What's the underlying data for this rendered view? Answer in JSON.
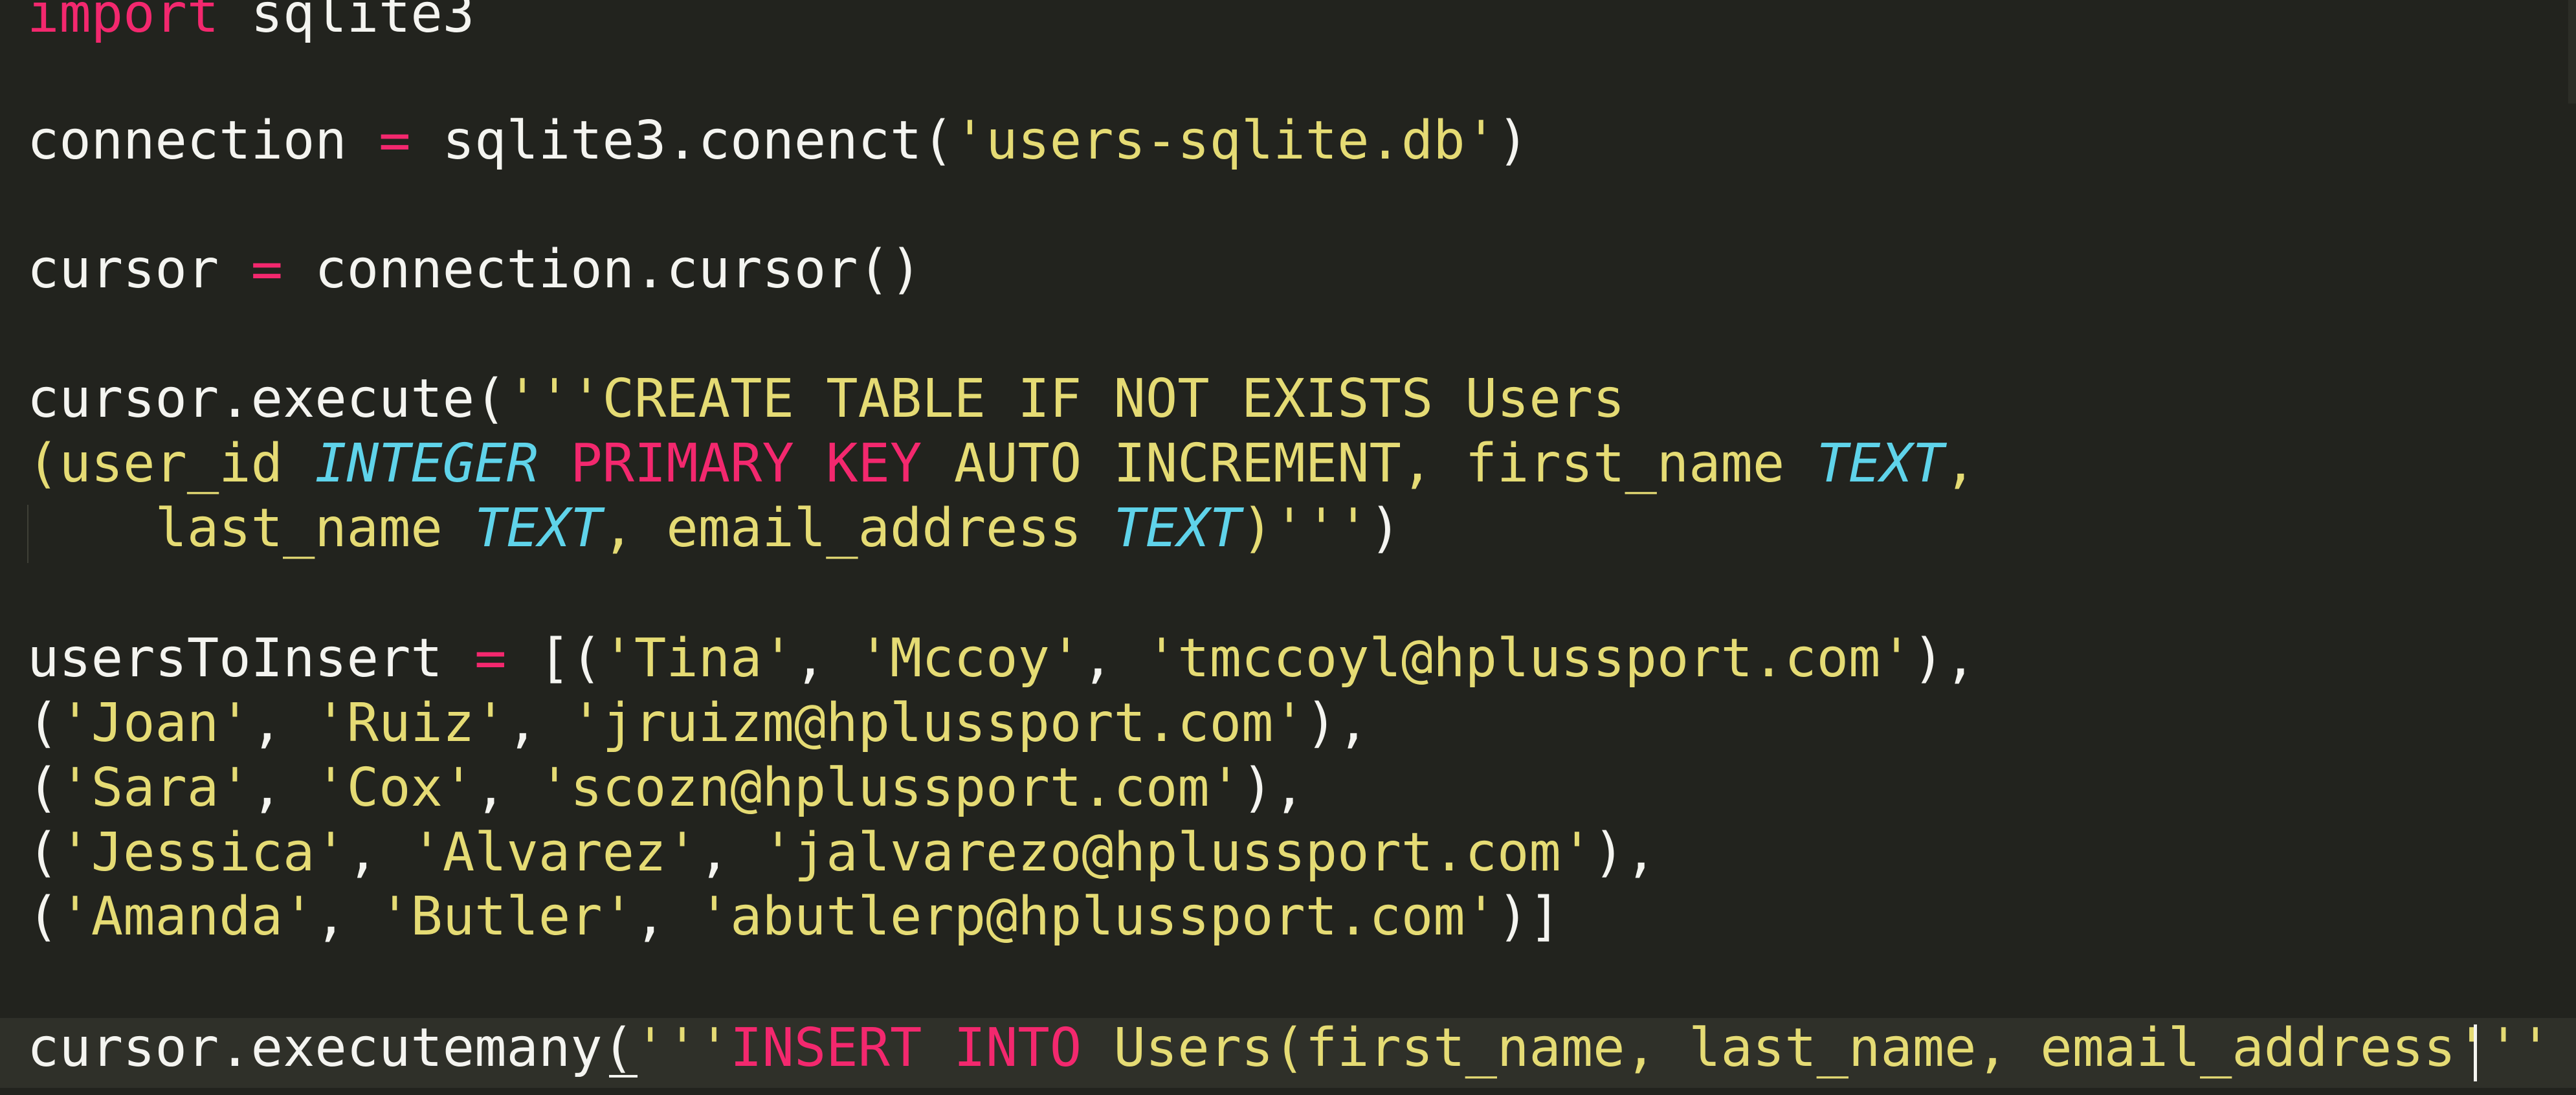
{
  "editor": {
    "theme_colors": {
      "background": "#22231e",
      "current_line": "#2f3029",
      "text": "#f4f4f0",
      "keyword": "#f3286e",
      "string": "#e5db74",
      "type": "#5fd3ea"
    },
    "lines": [
      [
        {
          "text": "import",
          "kind": "keyword"
        },
        {
          "text": " sqlite3",
          "kind": "normal"
        }
      ],
      [
        {
          "text": "connection ",
          "kind": "normal"
        },
        {
          "text": "=",
          "kind": "operator"
        },
        {
          "text": " sqlite3.conenct(",
          "kind": "normal"
        },
        {
          "text": "'users-sqlite.db'",
          "kind": "string"
        },
        {
          "text": ")",
          "kind": "normal"
        }
      ],
      [
        {
          "text": "cursor ",
          "kind": "normal"
        },
        {
          "text": "=",
          "kind": "operator"
        },
        {
          "text": " connection.cursor()",
          "kind": "normal"
        }
      ],
      [
        {
          "text": "cursor.execute(",
          "kind": "normal"
        },
        {
          "text": "'''CREATE TABLE IF NOT EXISTS Users",
          "kind": "string"
        }
      ],
      [
        {
          "text": "(user_id ",
          "kind": "string"
        },
        {
          "text": "INTEGER",
          "kind": "type"
        },
        {
          "text": " ",
          "kind": "string"
        },
        {
          "text": "PRIMARY KEY",
          "kind": "keyword"
        },
        {
          "text": " AUTO INCREMENT, first_name ",
          "kind": "string"
        },
        {
          "text": "TEXT",
          "kind": "type"
        },
        {
          "text": ",",
          "kind": "string"
        }
      ],
      [
        {
          "text": "    last_name ",
          "kind": "string"
        },
        {
          "text": "TEXT",
          "kind": "type"
        },
        {
          "text": ", email_address ",
          "kind": "string"
        },
        {
          "text": "TEXT",
          "kind": "type"
        },
        {
          "text": ")'''",
          "kind": "string"
        },
        {
          "text": ")",
          "kind": "normal"
        }
      ],
      [
        {
          "text": "usersToInsert ",
          "kind": "normal"
        },
        {
          "text": "=",
          "kind": "operator"
        },
        {
          "text": " [(",
          "kind": "normal"
        },
        {
          "text": "'Tina'",
          "kind": "string"
        },
        {
          "text": ", ",
          "kind": "normal"
        },
        {
          "text": "'Mccoy'",
          "kind": "string"
        },
        {
          "text": ", ",
          "kind": "normal"
        },
        {
          "text": "'tmccoyl@hplussport.com'",
          "kind": "string"
        },
        {
          "text": "),",
          "kind": "normal"
        }
      ],
      [
        {
          "text": "(",
          "kind": "normal"
        },
        {
          "text": "'Joan'",
          "kind": "string"
        },
        {
          "text": ", ",
          "kind": "normal"
        },
        {
          "text": "'Ruiz'",
          "kind": "string"
        },
        {
          "text": ", ",
          "kind": "normal"
        },
        {
          "text": "'jruizm@hplussport.com'",
          "kind": "string"
        },
        {
          "text": "),",
          "kind": "normal"
        }
      ],
      [
        {
          "text": "(",
          "kind": "normal"
        },
        {
          "text": "'Sara'",
          "kind": "string"
        },
        {
          "text": ", ",
          "kind": "normal"
        },
        {
          "text": "'Cox'",
          "kind": "string"
        },
        {
          "text": ", ",
          "kind": "normal"
        },
        {
          "text": "'scozn@hplussport.com'",
          "kind": "string"
        },
        {
          "text": "),",
          "kind": "normal"
        }
      ],
      [
        {
          "text": "(",
          "kind": "normal"
        },
        {
          "text": "'Jessica'",
          "kind": "string"
        },
        {
          "text": ", ",
          "kind": "normal"
        },
        {
          "text": "'Alvarez'",
          "kind": "string"
        },
        {
          "text": ", ",
          "kind": "normal"
        },
        {
          "text": "'jalvarezo@hplussport.com'",
          "kind": "string"
        },
        {
          "text": "),",
          "kind": "normal"
        }
      ],
      [
        {
          "text": "(",
          "kind": "normal"
        },
        {
          "text": "'Amanda'",
          "kind": "string"
        },
        {
          "text": ", ",
          "kind": "normal"
        },
        {
          "text": "'Butler'",
          "kind": "string"
        },
        {
          "text": ", ",
          "kind": "normal"
        },
        {
          "text": "'abutlerp@hplussport.com'",
          "kind": "string"
        },
        {
          "text": ")]",
          "kind": "normal"
        }
      ],
      [
        {
          "text": "cursor.executemany(",
          "kind": "normal"
        },
        {
          "text": "'''",
          "kind": "string"
        },
        {
          "text": "INSERT INTO",
          "kind": "keyword"
        },
        {
          "text": " Users(first_name, last_name, email_address",
          "kind": "string"
        },
        {
          "text": "'''",
          "kind": "string"
        }
      ]
    ]
  }
}
